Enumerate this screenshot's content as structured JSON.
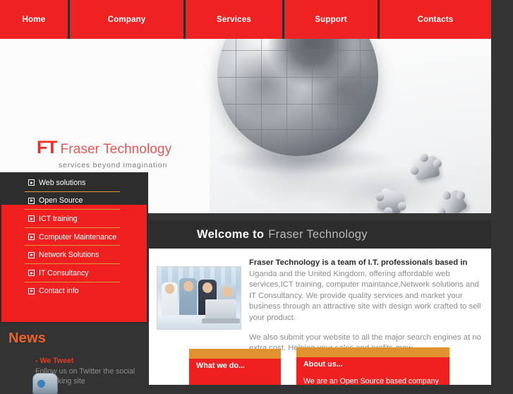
{
  "site": {
    "brand_short": "FT",
    "brand_name": "Fraser Technology",
    "tagline": "services beyond imagination",
    "colors": {
      "nav_red": "#ee2222",
      "menu_red": "#f02020",
      "dark": "#2d2d2d",
      "page_bg": "#333333",
      "orange": "#e2912f",
      "news_orange": "#e8622a",
      "logo_red": "#ef2b24",
      "divider_gold": "#d79a3c"
    }
  },
  "topnav": {
    "items": [
      {
        "label": "Home"
      },
      {
        "label": "Company"
      },
      {
        "label": "Services"
      },
      {
        "label": "Support"
      },
      {
        "label": "Contacts"
      }
    ]
  },
  "hero": {
    "image_alt": "metallic jigsaw puzzle globe with loose pieces"
  },
  "welcome": {
    "strong": "Welcome to",
    "light": "Fraser Technology"
  },
  "sidemenu": {
    "icon": "arrow-box-icon",
    "items": [
      {
        "label": "Web solutions"
      },
      {
        "label": "Open Source"
      },
      {
        "label": "ICT training"
      },
      {
        "label": "Computer Maintenance"
      },
      {
        "label": "Network Solutions"
      },
      {
        "label": "IT Consultancy"
      },
      {
        "label": "Contact info"
      }
    ]
  },
  "main": {
    "photo_alt": "business support team at desk with laptop",
    "lead": "Fraser Technology is a team of I.T. professionals based in",
    "paragraph1": " Uganda and the United Kingdom, offering affordable web services,ICT training, computer maintance,Network solutions and IT Consultancy. We provide quality services and market your business through an attractive site with design work crafted to sell your product.",
    "paragraph2": "We also submit your website to all the major search engines at no extra cost. Helping your sales and profits grow."
  },
  "news": {
    "title": "News",
    "items": [
      {
        "headline": "- We Tweet",
        "body": "Follow us on Twitter the social networking site",
        "thumb": "twitter-bird-icon"
      }
    ]
  },
  "promos": [
    {
      "id": "what-we-do",
      "title": "What we do...",
      "text": ""
    },
    {
      "id": "about-us",
      "title": "About us...",
      "text": "We are an Open Source based company"
    }
  ]
}
